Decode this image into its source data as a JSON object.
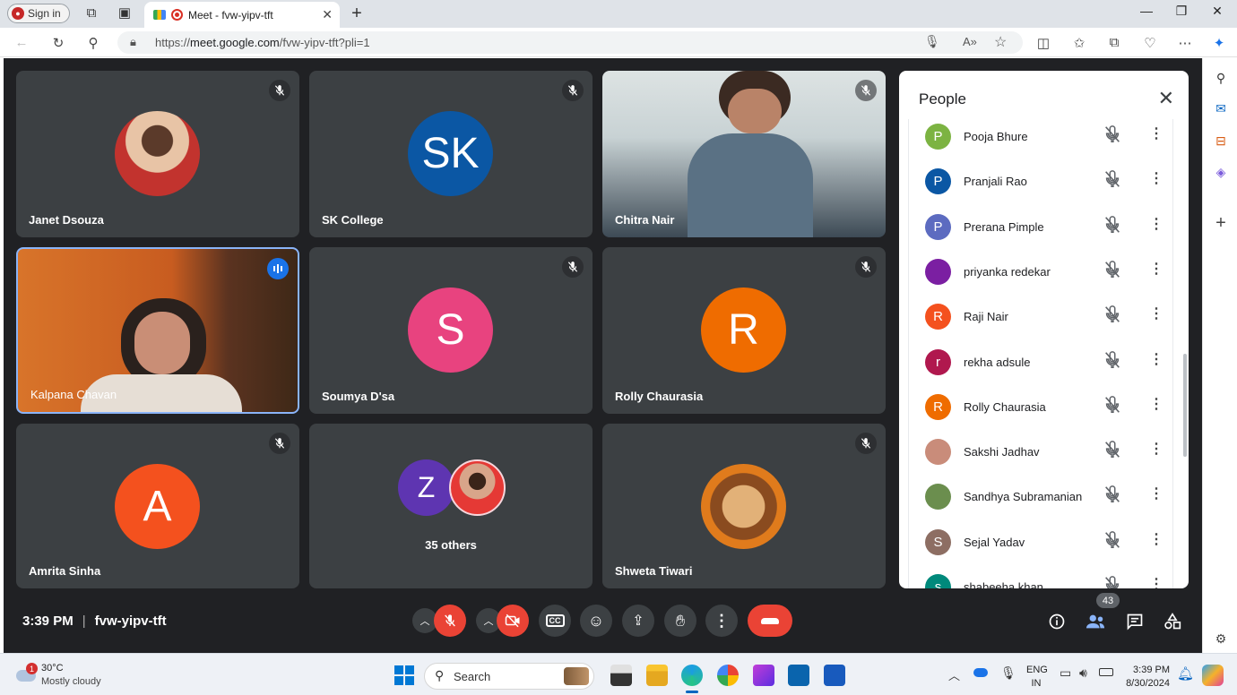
{
  "browser": {
    "signin_label": "Sign in",
    "tab_title": "Meet - fvw-yipv-tft",
    "url_scheme": "https://",
    "url_domain": "meet.google.com",
    "url_path": "/fvw-yipv-tft?pli=1"
  },
  "tiles": [
    {
      "name": "Janet Dsouza",
      "avatar": "",
      "color": "#e8d5c4",
      "muted": true
    },
    {
      "name": "SK College",
      "avatar": "SK",
      "color": "#0b57a4",
      "muted": true
    },
    {
      "name": "Chitra Nair",
      "avatar": "",
      "color": "",
      "muted": true,
      "video": true
    },
    {
      "name": "Kalpana Chavan",
      "avatar": "",
      "color": "",
      "muted": false,
      "video": true,
      "speaking": true
    },
    {
      "name": "Soumya D'sa",
      "avatar": "S",
      "color": "#e8437f",
      "muted": true
    },
    {
      "name": "Rolly Chaurasia",
      "avatar": "R",
      "color": "#ef6c00",
      "muted": true
    },
    {
      "name": "Amrita Sinha",
      "avatar": "A",
      "color": "#f4511e",
      "muted": true
    },
    {
      "name": "35 others",
      "avatar": "Z",
      "color": "#5e35b1",
      "muted": false
    },
    {
      "name": "Shweta Tiwari",
      "avatar": "",
      "color": "#c7782c",
      "muted": true
    }
  ],
  "meeting": {
    "time": "3:39 PM",
    "code": "fvw-yipv-tft",
    "participants_count": "43"
  },
  "people_panel": {
    "title": "People",
    "participants": [
      {
        "name": "Pooja Bhure",
        "initial": "P",
        "color": "#7cb342"
      },
      {
        "name": "Pranjali Rao",
        "initial": "P",
        "color": "#0b57a4"
      },
      {
        "name": "Prerana Pimple",
        "initial": "P",
        "color": "#5c6bc0"
      },
      {
        "name": "priyanka redekar",
        "initial": "",
        "color": "#7b1fa2"
      },
      {
        "name": "Raji Nair",
        "initial": "R",
        "color": "#f4511e"
      },
      {
        "name": "rekha adsule",
        "initial": "r",
        "color": "#b0184e"
      },
      {
        "name": "Rolly Chaurasia",
        "initial": "R",
        "color": "#ef6c00"
      },
      {
        "name": "Sakshi Jadhav",
        "initial": "",
        "color": "#c98c7a"
      },
      {
        "name": "Sandhya Subramanian",
        "initial": "",
        "color": "#6b8e4e"
      },
      {
        "name": "Sejal Yadav",
        "initial": "S",
        "color": "#8d6e63"
      },
      {
        "name": "shabeeha khan",
        "initial": "s",
        "color": "#00897b"
      }
    ]
  },
  "taskbar": {
    "notification_count": "1",
    "temperature": "30°C",
    "weather_desc": "Mostly cloudy",
    "search_label": "Search",
    "lang_top": "ENG",
    "lang_bottom": "IN",
    "time": "3:39 PM",
    "date": "8/30/2024"
  }
}
